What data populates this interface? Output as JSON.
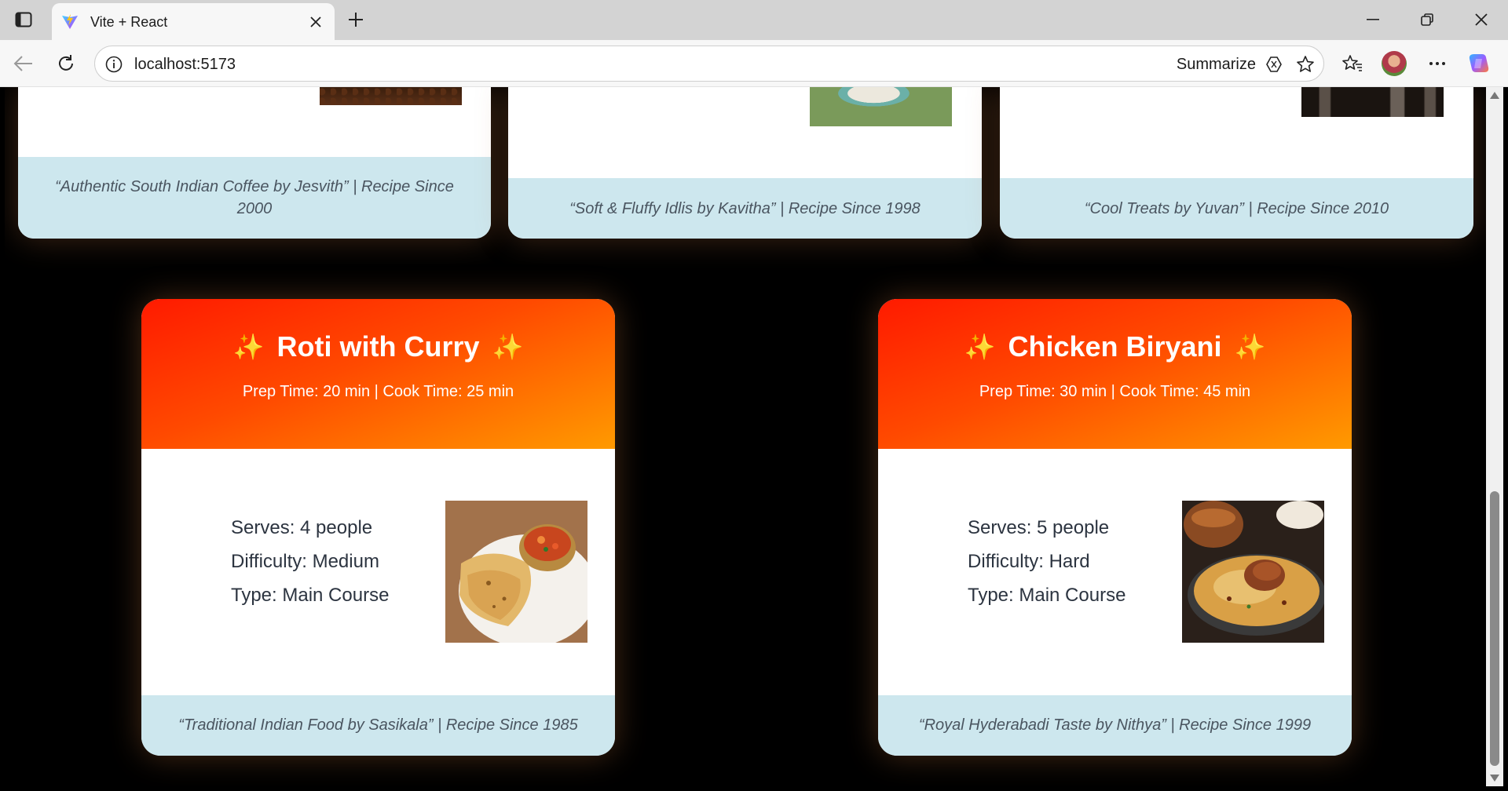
{
  "browser": {
    "tab_title": "Vite + React",
    "url": "localhost:5173",
    "summarize_label": "Summarize"
  },
  "top_cards": [
    {
      "footer": "“Authentic South Indian Coffee by Jesvith” | Recipe Since 2000",
      "image": "coffee-beans"
    },
    {
      "footer": "“Soft & Fluffy Idlis by Kavitha” | Recipe Since 1998",
      "image": "idli-plate"
    },
    {
      "footer": "“Cool Treats by Yuvan” | Recipe Since 2010",
      "image": "cold-drinks"
    }
  ],
  "cards": [
    {
      "sparkle": "✨",
      "title": "Roti with Curry",
      "times": "Prep Time: 20 min | Cook Time: 25 min",
      "serves": "Serves: 4 people",
      "difficulty": "Difficulty: Medium",
      "type": "Type: Main Course",
      "footer": "“Traditional Indian Food by Sasikala” | Recipe Since 1985",
      "image": "roti-curry-photo"
    },
    {
      "sparkle": "✨",
      "title": "Chicken Biryani",
      "times": "Prep Time: 30 min | Cook Time: 45 min",
      "serves": "Serves: 5 people",
      "difficulty": "Difficulty: Hard",
      "type": "Type: Main Course",
      "footer": "“Royal Hyderabadi Taste by Nithya” | Recipe Since 1999",
      "image": "chicken-biryani-photo"
    }
  ],
  "colors": {
    "header_gradient_start": "#ff1a00",
    "header_gradient_end": "#ff9a00",
    "footer_bg": "#cde7ee",
    "page_bg": "#000000"
  }
}
